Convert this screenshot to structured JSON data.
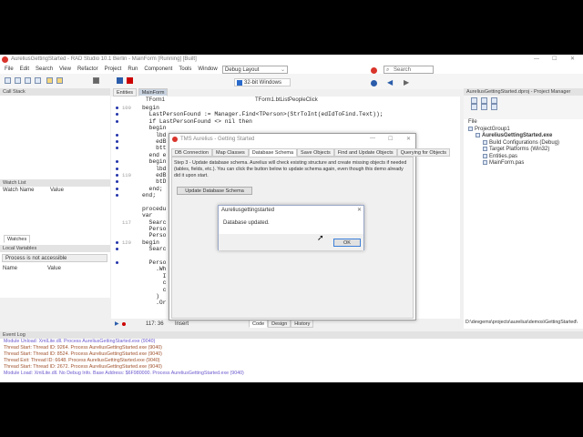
{
  "window": {
    "title": "AureliusGettingStarted - RAD Studio 10.1 Berlin - MainForm [Running] [Built]"
  },
  "menu": [
    "File",
    "Edit",
    "Search",
    "View",
    "Refactor",
    "Project",
    "Run",
    "Component",
    "Tools",
    "Window",
    "Help"
  ],
  "toolbar": {
    "layout": "Debug Layout",
    "platform": "32-bit Windows",
    "search_placeholder": "Search"
  },
  "call_stack": {
    "title": "Call Stack"
  },
  "watch_list": {
    "title": "Watch List",
    "cols": [
      "Watch Name",
      "Value"
    ],
    "tab": "Watches"
  },
  "local_vars": {
    "title": "Local Variables",
    "process": "Process is not accessible",
    "cols": [
      "Name",
      "Value"
    ]
  },
  "editor": {
    "tabs": [
      "Entities",
      "MainForm"
    ],
    "class_combo": "TForm1",
    "method_combo": "TForm1.btListPeopleClick",
    "lines": [
      {
        "n": "100",
        "t": "begin",
        "dot": true
      },
      {
        "n": "",
        "t": "  LastPersonFound := Manager.Find<TPerson>(StrToInt(edIdToFind.Text));",
        "dot": true
      },
      {
        "n": "",
        "t": "  if LastPersonFound <> nil then",
        "dot": true
      },
      {
        "n": "",
        "t": "  begin",
        "dot": false
      },
      {
        "n": "",
        "t": "    lbd",
        "dot": true
      },
      {
        "n": "",
        "t": "    edB",
        "dot": true
      },
      {
        "n": "",
        "t": "    btt",
        "dot": true
      },
      {
        "n": "",
        "t": "  end e",
        "dot": false
      },
      {
        "n": "",
        "t": "  begin",
        "dot": true
      },
      {
        "n": "",
        "t": "    lbd",
        "dot": true
      },
      {
        "n": "110",
        "t": "    edB",
        "dot": true
      },
      {
        "n": "",
        "t": "    btD",
        "dot": true
      },
      {
        "n": "",
        "t": "  end;",
        "dot": true
      },
      {
        "n": "",
        "t": "end;",
        "dot": true
      },
      {
        "n": "",
        "t": "",
        "dot": false
      },
      {
        "n": "",
        "t": "procedu",
        "dot": false
      },
      {
        "n": "",
        "t": "var",
        "dot": false
      },
      {
        "n": "117",
        "t": "  Searc",
        "dot": false
      },
      {
        "n": "",
        "t": "  Perso",
        "dot": false
      },
      {
        "n": "",
        "t": "  Perso",
        "dot": false
      },
      {
        "n": "120",
        "t": "begin",
        "dot": true
      },
      {
        "n": "",
        "t": "  Searc",
        "dot": true
      },
      {
        "n": "",
        "t": "",
        "dot": false
      },
      {
        "n": "",
        "t": "  Perso",
        "dot": true
      },
      {
        "n": "",
        "t": "    .Wh",
        "dot": false
      },
      {
        "n": "",
        "t": "      I",
        "dot": false
      },
      {
        "n": "",
        "t": "      c",
        "dot": false
      },
      {
        "n": "",
        "t": "      c",
        "dot": false
      },
      {
        "n": "",
        "t": "    )",
        "dot": false
      },
      {
        "n": "",
        "t": "    .Or",
        "dot": false
      }
    ],
    "position": "117: 36",
    "mode": "Insert",
    "view_tabs": [
      "Code",
      "Design",
      "History"
    ]
  },
  "project_manager": {
    "title": "AureliusGettingStarted.dproj - Project Manager",
    "file_label": "File",
    "tree": [
      {
        "label": "ProjectGroup1",
        "level": 0,
        "bold": false
      },
      {
        "label": "AureliusGettingStarted.exe",
        "level": 1,
        "bold": true
      },
      {
        "label": "Build Configurations (Debug)",
        "level": 2,
        "bold": false
      },
      {
        "label": "Target Platforms (Win32)",
        "level": 2,
        "bold": false
      },
      {
        "label": "Entities.pas",
        "level": 2,
        "bold": false
      },
      {
        "label": "MainForm.pas",
        "level": 2,
        "bold": false
      }
    ],
    "path": "D:\\devgems\\projects\\aurelius\\demos\\GettingStarted\\"
  },
  "app_dialog": {
    "title": "TMS Aurelius - Getting Started",
    "tabs": [
      "DB Connection",
      "Map Classes",
      "Database Schema",
      "Save Objects",
      "Find and Update Objects",
      "Querying for Objects"
    ],
    "active_tab": 2,
    "description": "Step 3 - Update database schema. Aurelius will check existing structure and create missing objects if needed (tables, fields, etc.). You can click the button below to update schema again, even though this demo already did it upon start.",
    "button": "Update Database Schema"
  },
  "message_box": {
    "title": "Aureliusgettingstarted",
    "message": "Database updated.",
    "ok": "OK"
  },
  "event_log": {
    "title": "Event Log",
    "entries": [
      {
        "text": "Module Unload: XmlLite.dll. Process AureliusGettingStarted.exe (9040)",
        "type": "module"
      },
      {
        "text": "Thread Start: Thread ID: 9264. Process AureliusGettingStarted.exe (9040)",
        "type": "thread"
      },
      {
        "text": "Thread Start: Thread ID: 8524. Process AureliusGettingStarted.exe (9040)",
        "type": "thread"
      },
      {
        "text": "Thread Exit: Thread ID: 6648. Process AureliusGettingStarted.exe (9040)",
        "type": "thread"
      },
      {
        "text": "Thread Start: Thread ID: 2672. Process AureliusGettingStarted.exe (9040)",
        "type": "thread"
      },
      {
        "text": "Module Load: XmlLite.dll. No Debug Info. Base Address: $6F980000. Process AureliusGettingStarted.exe (9040)",
        "type": "module"
      }
    ]
  }
}
